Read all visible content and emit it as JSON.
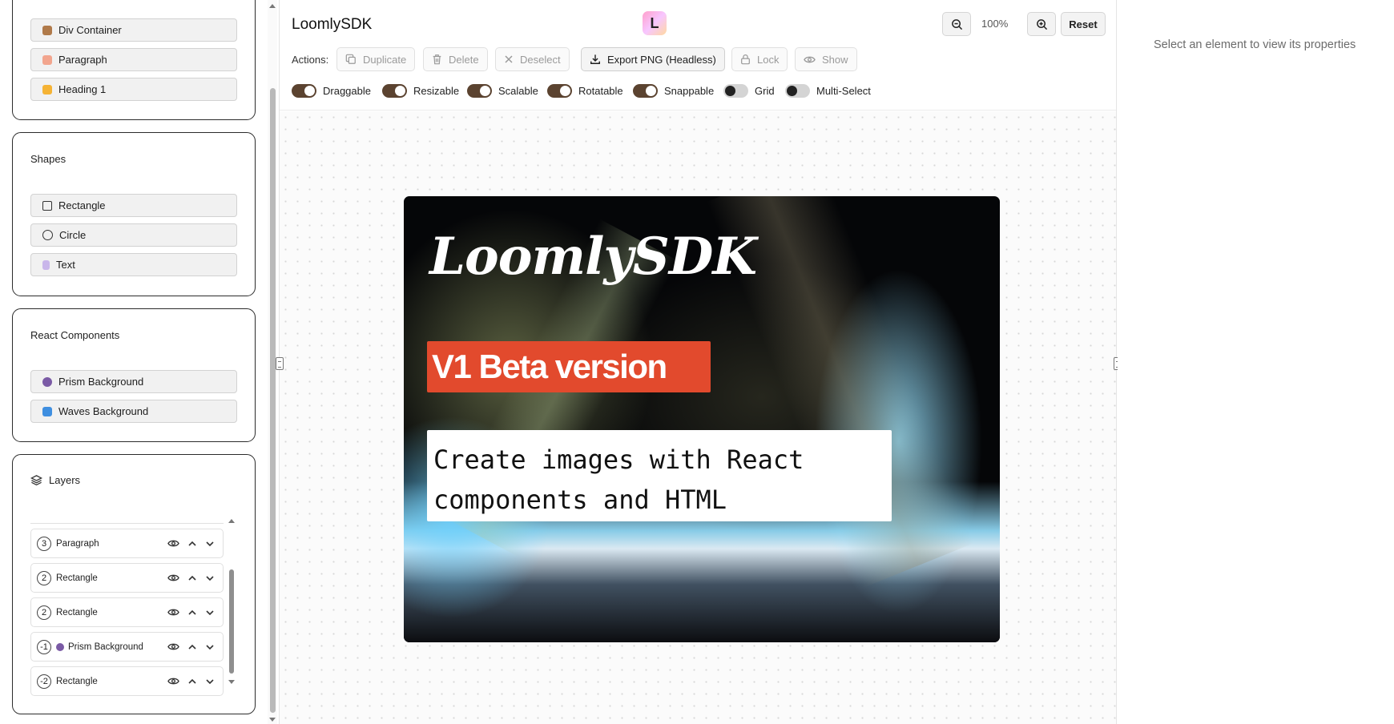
{
  "sidebar": {
    "html_elements": [
      {
        "label": "Div Container",
        "icon": "box-icon",
        "color": "#b07a4a"
      },
      {
        "label": "Paragraph",
        "icon": "memo-icon",
        "color": "#f2a58e"
      },
      {
        "label": "Heading 1",
        "icon": "pencil-icon",
        "color": "#f5b335"
      }
    ],
    "shapes": {
      "title": "Shapes",
      "items": [
        {
          "label": "Rectangle",
          "icon": "square-icon"
        },
        {
          "label": "Circle",
          "icon": "circle-icon"
        },
        {
          "label": "Text",
          "icon": "text-icon",
          "color": "#c9b6ea"
        }
      ]
    },
    "react_components": {
      "title": "React Components",
      "items": [
        {
          "label": "Prism Background",
          "icon": "crystal-ball-icon",
          "color": "#7a5aa5"
        },
        {
          "label": "Waves Background",
          "icon": "wave-icon",
          "color": "#3f8fe0"
        }
      ]
    },
    "layers": {
      "title": "Layers",
      "items": [
        {
          "z": "3",
          "label": "Paragraph"
        },
        {
          "z": "2",
          "label": "Rectangle"
        },
        {
          "z": "2",
          "label": "Rectangle"
        },
        {
          "z": "-1",
          "label": "Prism Background",
          "icon": "crystal-ball-icon"
        },
        {
          "z": "-2",
          "label": "Rectangle"
        }
      ]
    }
  },
  "toolbar": {
    "title": "LoomlySDK",
    "logo_glyph": "L",
    "zoom_level": "100%",
    "reset_label": "Reset",
    "actions_label": "Actions:",
    "actions": [
      {
        "label": "Duplicate",
        "enabled": false
      },
      {
        "label": "Delete",
        "enabled": false
      },
      {
        "label": "Deselect",
        "enabled": false
      },
      {
        "label": "Export PNG (Headless)",
        "enabled": true
      },
      {
        "label": "Lock",
        "enabled": false
      },
      {
        "label": "Show",
        "enabled": false
      }
    ],
    "toggles": [
      {
        "label": "Draggable",
        "on": true
      },
      {
        "label": "Resizable",
        "on": true
      },
      {
        "label": "Scalable",
        "on": true
      },
      {
        "label": "Rotatable",
        "on": true
      },
      {
        "label": "Snappable",
        "on": true
      },
      {
        "label": "Grid",
        "on": false
      },
      {
        "label": "Multi-Select",
        "on": false
      }
    ]
  },
  "canvas": {
    "logo_text": "LoomlySDK",
    "badge_text": "V1 Beta version",
    "badge_color": "#e24a2d",
    "tagline_line1": "Create images with React",
    "tagline_line2": "components and HTML"
  },
  "properties": {
    "empty_message": "Select an element to view its properties"
  }
}
